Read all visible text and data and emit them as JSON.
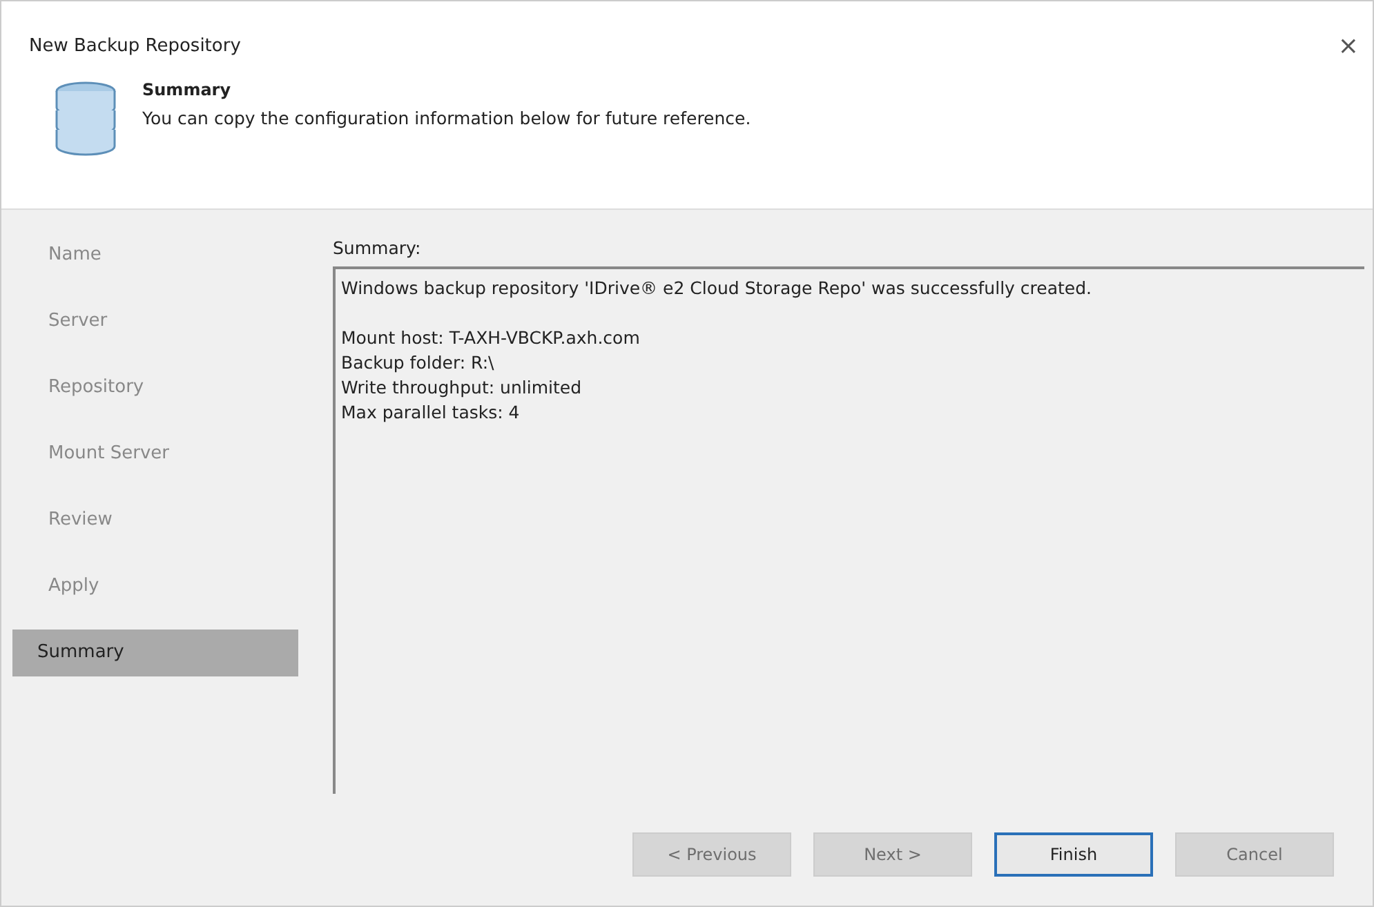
{
  "window": {
    "title": "New Backup Repository",
    "close": "×"
  },
  "header": {
    "title": "Summary",
    "subtitle": "You can copy the configuration information below for future reference."
  },
  "steps": [
    {
      "label": "Name",
      "selected": false
    },
    {
      "label": "Server",
      "selected": false
    },
    {
      "label": "Repository",
      "selected": false
    },
    {
      "label": "Mount Server",
      "selected": false
    },
    {
      "label": "Review",
      "selected": false
    },
    {
      "label": "Apply",
      "selected": false
    },
    {
      "label": "Summary",
      "selected": true
    }
  ],
  "summary": {
    "label": "Summary:",
    "message": "Windows backup repository 'IDrive® e2 Cloud Storage Repo' was successfully created.",
    "lines": [
      "Mount host: T-AXH-VBCKP.axh.com",
      "Backup folder: R:\\",
      "Write throughput: unlimited",
      "Max parallel tasks: 4"
    ]
  },
  "buttons": [
    {
      "label": "< Previous",
      "disabled": true,
      "default": false
    },
    {
      "label": "Next >",
      "disabled": true,
      "default": false
    },
    {
      "label": "Finish",
      "disabled": false,
      "default": true
    },
    {
      "label": "Cancel",
      "disabled": true,
      "default": false
    }
  ]
}
